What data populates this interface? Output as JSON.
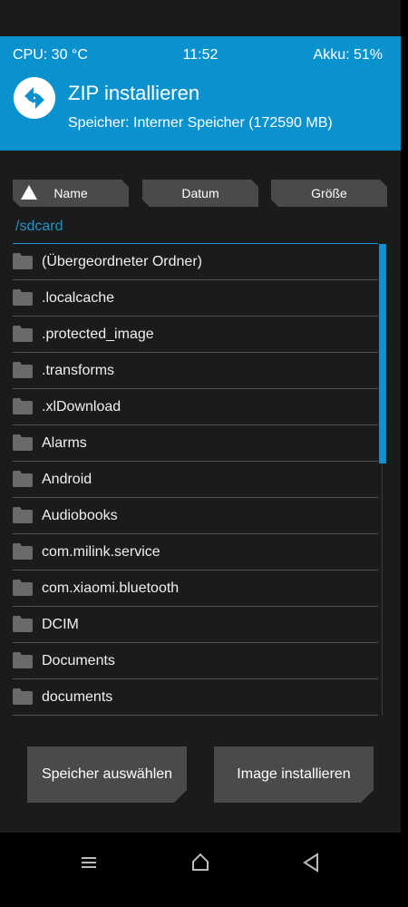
{
  "status": {
    "cpu": "CPU: 30 °C",
    "time": "11:52",
    "battery": "Akku: 51%"
  },
  "header": {
    "title": "ZIP installieren",
    "storage": "Speicher: Interner Speicher (172590 MB)",
    "logo_icon": "twrp-logo-icon"
  },
  "sort": {
    "name": "Name",
    "date": "Datum",
    "size": "Größe"
  },
  "path": "/sdcard",
  "files": [
    "(Übergeordneter Ordner)",
    ".localcache",
    ".protected_image",
    ".transforms",
    ".xlDownload",
    "Alarms",
    "Android",
    "Audiobooks",
    "com.milink.service",
    "com.xiaomi.bluetooth",
    "DCIM",
    "Documents",
    "documents"
  ],
  "buttons": {
    "select_storage": "Speicher auswählen",
    "install_image": "Image installieren"
  },
  "colors": {
    "accent": "#0a92cf",
    "background": "#1b1b1b",
    "button": "#4a4a4a"
  }
}
